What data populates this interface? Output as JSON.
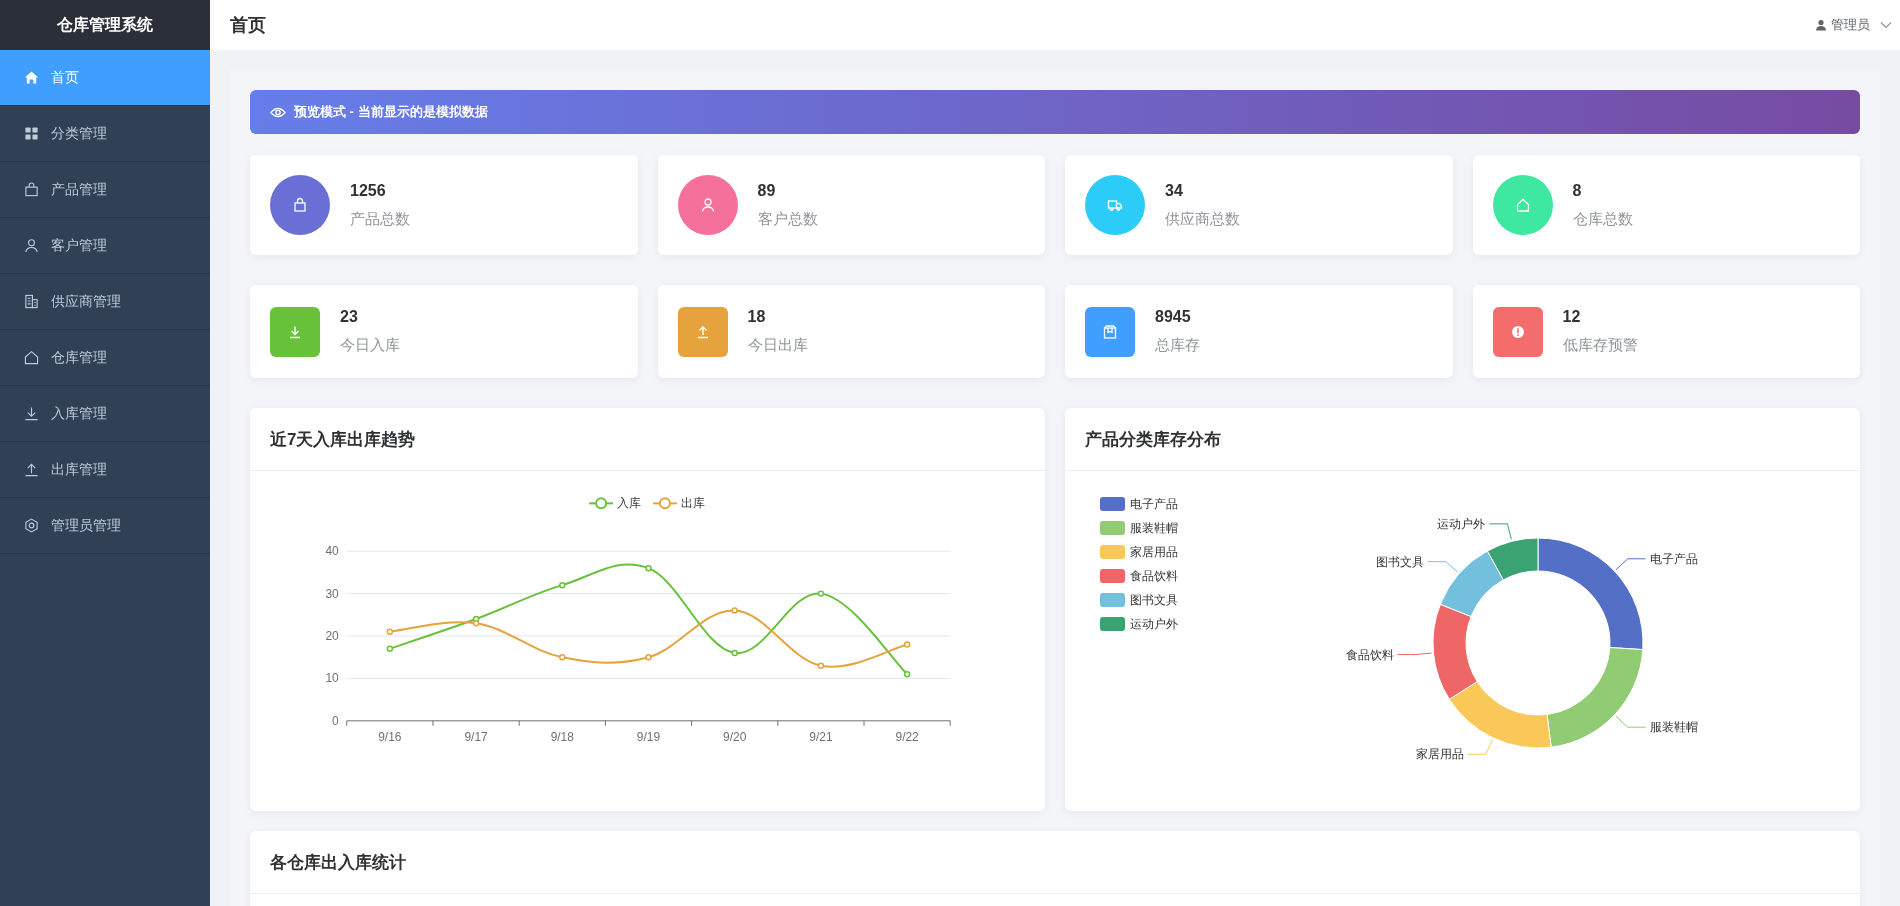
{
  "sidebar": {
    "title": "仓库管理系统",
    "items": [
      {
        "label": "首页",
        "selected": true
      },
      {
        "label": "分类管理",
        "selected": false
      },
      {
        "label": "产品管理",
        "selected": false
      },
      {
        "label": "客户管理",
        "selected": false
      },
      {
        "label": "供应商管理",
        "selected": false
      },
      {
        "label": "仓库管理",
        "selected": false
      },
      {
        "label": "入库管理",
        "selected": false
      },
      {
        "label": "出库管理",
        "selected": false
      },
      {
        "label": "管理员管理",
        "selected": false
      }
    ]
  },
  "header": {
    "title": "首页",
    "user": "管理员"
  },
  "banner": {
    "text": "预览模式 - 当前显示的是模拟数据"
  },
  "stats": [
    {
      "value": "1256",
      "label": "产品总数",
      "color": "#6a6fd6"
    },
    {
      "value": "89",
      "label": "客户总数",
      "color": "#f5709a"
    },
    {
      "value": "34",
      "label": "供应商总数",
      "color": "#2bcdf8"
    },
    {
      "value": "8",
      "label": "仓库总数",
      "color": "#3fe8a0"
    }
  ],
  "today_stats": [
    {
      "value": "23",
      "label": "今日入库",
      "color": "#67c23a"
    },
    {
      "value": "18",
      "label": "今日出库",
      "color": "#e6a23c"
    },
    {
      "value": "8945",
      "label": "总库存",
      "color": "#409eff"
    },
    {
      "value": "12",
      "label": "低库存预警",
      "color": "#f56c6c"
    }
  ],
  "trend_card": {
    "title": "近7天入库出库趋势",
    "chart_data": {
      "type": "line",
      "grid": true,
      "legend": true,
      "categories": [
        "9/16",
        "9/17",
        "9/18",
        "9/19",
        "9/20",
        "9/21",
        "9/22"
      ],
      "ylim": [
        0,
        40
      ],
      "yticks": [
        0,
        10,
        20,
        30,
        40
      ],
      "series": [
        {
          "name": "入库",
          "color": "#67c23a",
          "marker": "circle",
          "values": [
            17,
            24,
            32,
            36,
            16,
            30,
            11
          ]
        },
        {
          "name": "出库",
          "color": "#e6a23c",
          "marker": "circle",
          "values": [
            21,
            23,
            15,
            15,
            26,
            13,
            18
          ]
        }
      ]
    }
  },
  "category_card": {
    "title": "产品分类库存分布",
    "chart_data": {
      "type": "donut",
      "legend": true,
      "categories": [
        "电子产品",
        "服装鞋帽",
        "家居用品",
        "食品饮料",
        "图书文具",
        "运动户外"
      ],
      "series": [
        {
          "values": [
            26,
            22,
            18,
            15,
            11,
            8
          ]
        }
      ],
      "colors": [
        "#5470c6",
        "#91cc75",
        "#fac858",
        "#ee6666",
        "#73c0de",
        "#3ba272"
      ]
    }
  },
  "warehouse_card": {
    "title": "各仓库出入库统计"
  }
}
